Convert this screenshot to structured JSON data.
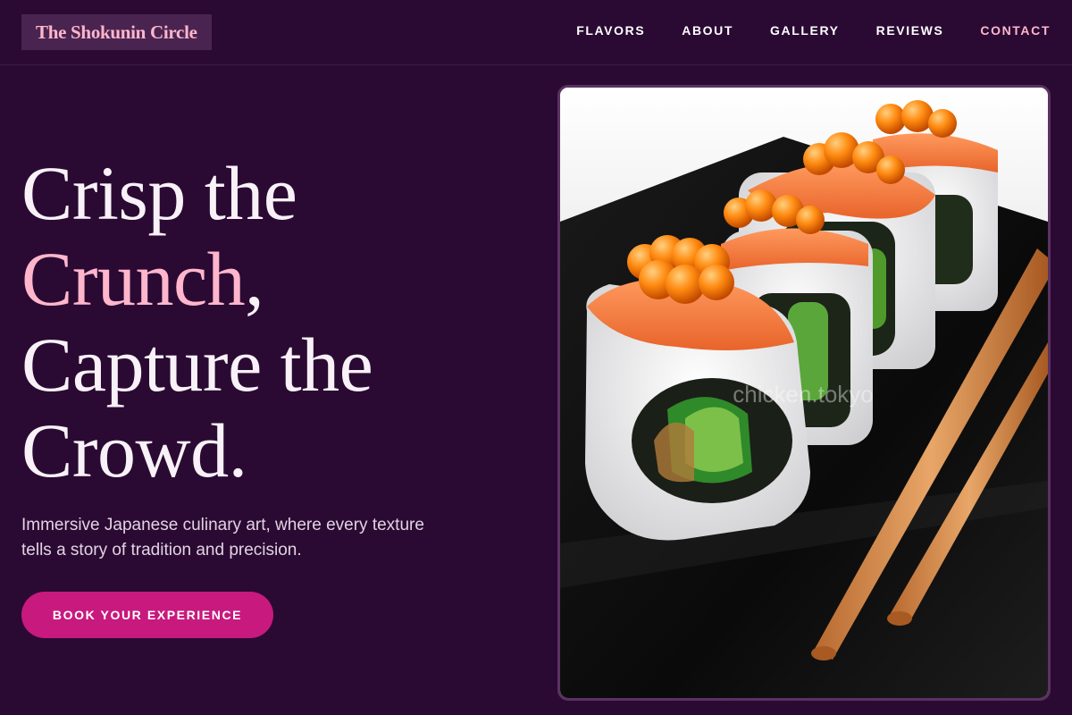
{
  "brand": {
    "name": "The Shokunin Circle"
  },
  "nav": {
    "items": [
      {
        "label": "FLAVORS"
      },
      {
        "label": "ABOUT"
      },
      {
        "label": "GALLERY"
      },
      {
        "label": "REVIEWS"
      },
      {
        "label": "CONTACT"
      }
    ]
  },
  "hero": {
    "headline": {
      "line1": "Crisp the",
      "line2_highlight": "Crunch",
      "line2_rest": ",",
      "line3": "Capture the",
      "line4": "Crowd."
    },
    "subtext": "Immersive Japanese culinary art, where every texture tells a story of tradition and precision.",
    "cta_label": "BOOK YOUR EXPERIENCE",
    "image": {
      "watermark": "chicken.tokyo",
      "icon": "sushi-photo"
    }
  },
  "colors": {
    "background": "#2a0a33",
    "accent_pink": "#ffb6cc",
    "button": "#c8197e",
    "logo_bg": "#4a2450"
  }
}
